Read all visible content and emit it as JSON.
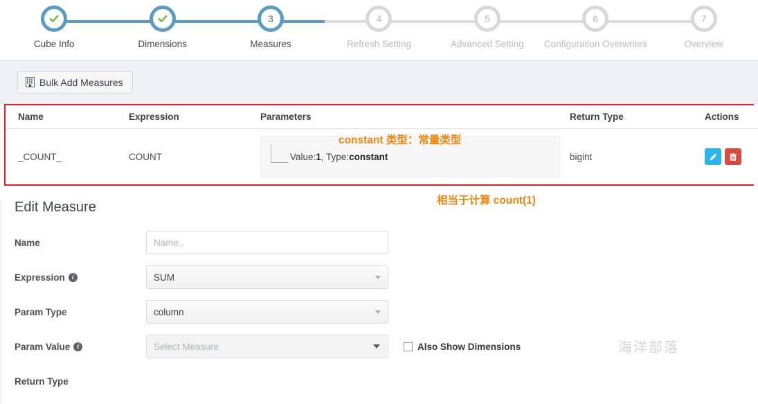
{
  "stepper": {
    "steps": [
      {
        "num": "1",
        "label": "Cube Info",
        "state": "done"
      },
      {
        "num": "2",
        "label": "Dimensions",
        "state": "done"
      },
      {
        "num": "3",
        "label": "Measures",
        "state": "current"
      },
      {
        "num": "4",
        "label": "Refresh Setting",
        "state": "pending"
      },
      {
        "num": "5",
        "label": "Advanced Setting",
        "state": "pending"
      },
      {
        "num": "6",
        "label": "Configuration Overwrites",
        "state": "pending"
      },
      {
        "num": "7",
        "label": "Overview",
        "state": "pending"
      }
    ]
  },
  "toolbar": {
    "bulk_add_label": "Bulk Add Measures",
    "bulk_add_icon": "grid-table-icon"
  },
  "measures_table": {
    "columns": [
      "Name",
      "Expression",
      "Parameters",
      "Return Type",
      "Actions"
    ],
    "rows": [
      {
        "name": "_COUNT_",
        "expression": "COUNT",
        "param_value_label": "Value:",
        "param_value": "1",
        "param_type_label": ", Type:",
        "param_type": "constant",
        "return_type": "bigint",
        "edit_icon": "pencil-icon",
        "delete_icon": "trash-icon"
      }
    ]
  },
  "annotations": {
    "constant_note": "constant 类型：常量类型",
    "count_note": "相当于计算 count(1)",
    "highlight_color": "#ef1d1d",
    "note_color": "#f2850d"
  },
  "edit_measure": {
    "title": "Edit Measure",
    "fields": {
      "name": {
        "label": "Name",
        "value": "",
        "placeholder": "Name.."
      },
      "expression": {
        "label": "Expression",
        "value": "SUM",
        "has_info": true
      },
      "param_type": {
        "label": "Param Type",
        "value": "column"
      },
      "param_value": {
        "label": "Param Value",
        "value": "",
        "placeholder": "Select Measure",
        "has_info": true
      },
      "return_type": {
        "label": "Return Type"
      }
    },
    "checkbox": {
      "label": "Also Show Dimensions",
      "checked": false
    }
  },
  "watermark": "海洋部落",
  "colors": {
    "step_active": "#5b9bc4",
    "step_inactive": "#d8d8d8",
    "check_green": "#7ac143",
    "edit_button": "#2cb4e8",
    "delete_button": "#d94a3f"
  }
}
